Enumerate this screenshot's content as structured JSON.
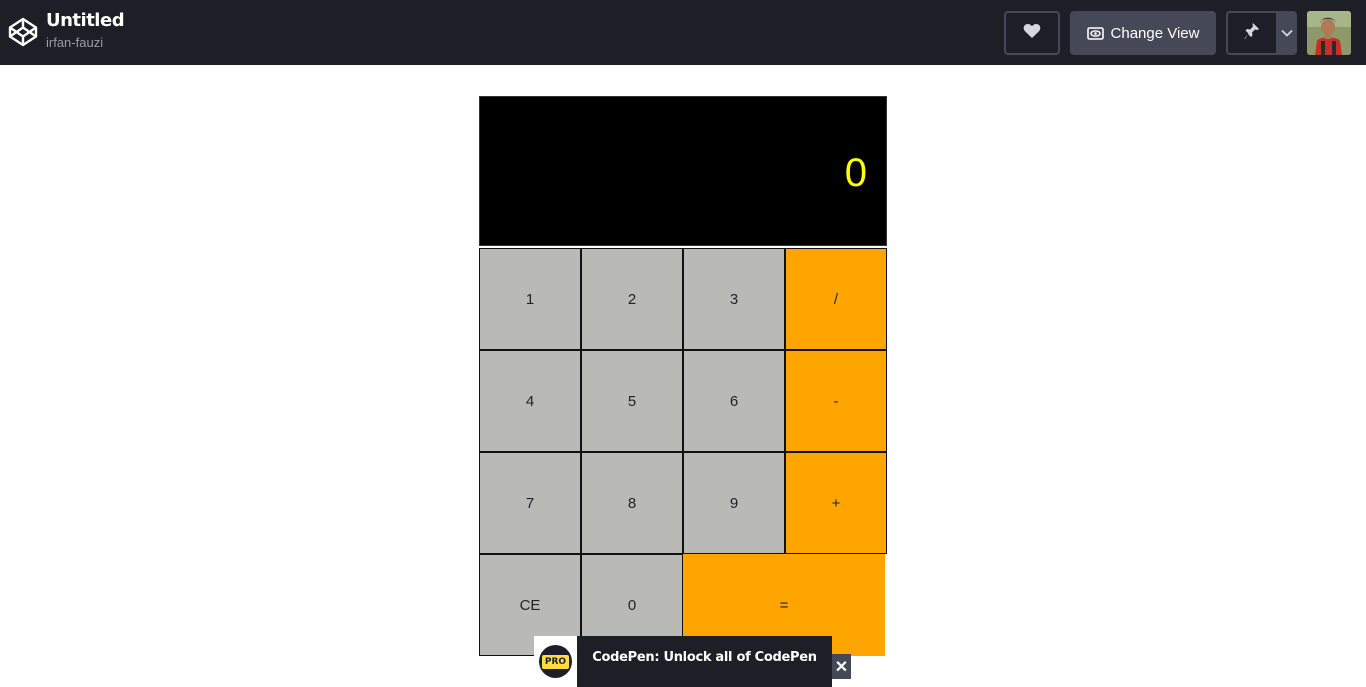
{
  "header": {
    "logo_icon": "codepen-logo-icon",
    "pen_title": "Untitled",
    "author": "irfan-fauzi",
    "heart_icon": "heart-icon",
    "change_view_label": "Change View",
    "change_view_icon": "eye-icon",
    "pin_icon": "pin-icon",
    "pin_menu_icon": "chevron-down-icon",
    "avatar": "user-avatar"
  },
  "calculator": {
    "display_value": "0",
    "display_color": "#ffff00",
    "number_key_color": "#b9bab5",
    "operator_key_color": "#ffa500",
    "keys": {
      "k1": "1",
      "k2": "2",
      "k3": "3",
      "div": "/",
      "k4": "4",
      "k5": "5",
      "k6": "6",
      "minus": "-",
      "k7": "7",
      "k8": "8",
      "k9": "9",
      "plus": "+",
      "ce": "CE",
      "k0": "0",
      "equals": "="
    }
  },
  "promo": {
    "badge": "PRO",
    "text": "CodePen: Unlock all of CodePen",
    "close_label": "✕"
  }
}
